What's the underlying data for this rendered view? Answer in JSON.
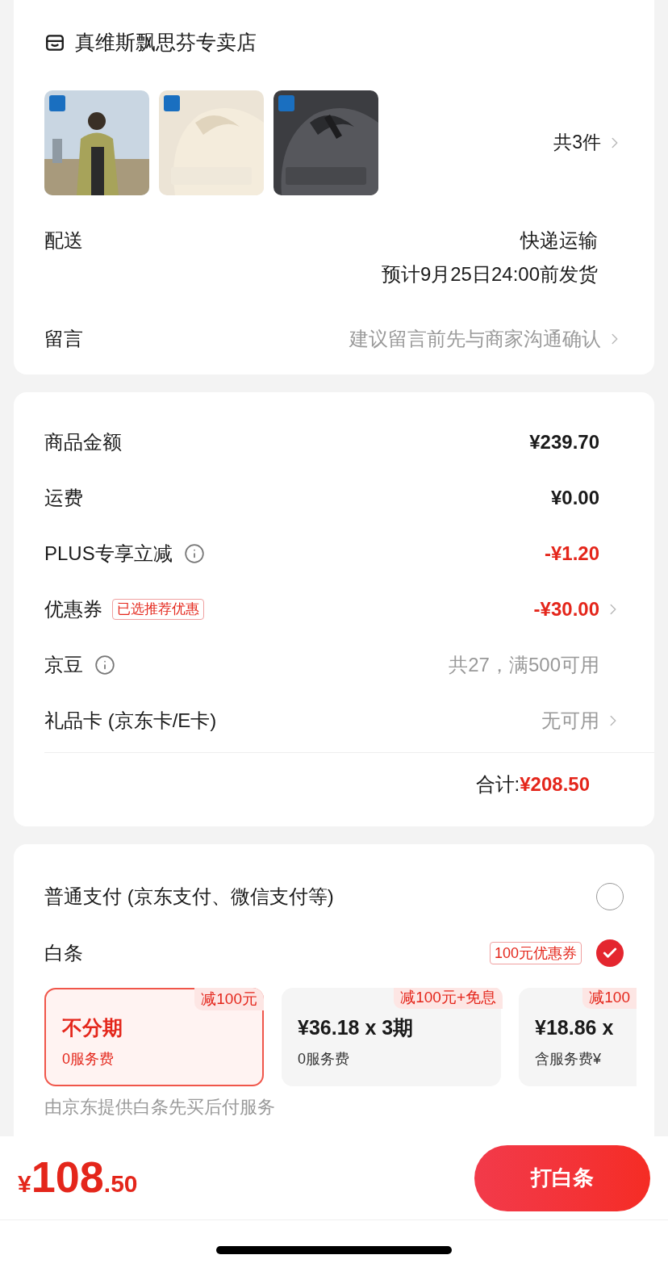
{
  "store": {
    "name": "真维斯飘思芬专卖店"
  },
  "item_count": "共3件",
  "delivery": {
    "label": "配送",
    "method": "快递运输",
    "eta": "预计9月25日24:00前发货"
  },
  "message": {
    "label": "留言",
    "placeholder": "建议留言前先与商家沟通确认"
  },
  "summary": [
    {
      "label": "商品金额",
      "value": "¥239.70",
      "kind": "amount",
      "info": false,
      "chevron": false
    },
    {
      "label": "运费",
      "value": "¥0.00",
      "kind": "amount",
      "info": false,
      "chevron": false
    },
    {
      "label": "PLUS专享立减",
      "value": "-¥1.20",
      "kind": "discount",
      "info": true,
      "chevron": false
    },
    {
      "label": "优惠券",
      "tag": "已选推荐优惠",
      "value": "-¥30.00",
      "kind": "discount",
      "info": false,
      "chevron": true
    },
    {
      "label": "京豆",
      "value": "共27，满500可用",
      "kind": "muted",
      "info": true,
      "chevron": false
    },
    {
      "label": "礼品卡 (京东卡/E卡)",
      "value": "无可用",
      "kind": "muted",
      "info": false,
      "chevron": true
    }
  ],
  "total": {
    "label": "合计:",
    "value": "¥208.50"
  },
  "payment_methods": [
    {
      "label": "普通支付 (京东支付、微信支付等)",
      "selected": false
    },
    {
      "label": "白条",
      "tag": "100元优惠券",
      "selected": true
    }
  ],
  "plans": [
    {
      "badge": "减100元",
      "title": "不分期",
      "subtitle": "0服务费",
      "selected": true
    },
    {
      "badge": "减100元+免息",
      "title": "¥36.18 x 3期",
      "subtitle": "0服务费",
      "selected": false
    },
    {
      "badge": "减100",
      "title": "¥18.86 x",
      "subtitle": "含服务费¥",
      "selected": false
    }
  ],
  "footnote": "由京东提供白条先买后付服务",
  "bottom_bar": {
    "currency": "¥",
    "integer": "108",
    "decimal": ".50",
    "button": "打白条"
  }
}
